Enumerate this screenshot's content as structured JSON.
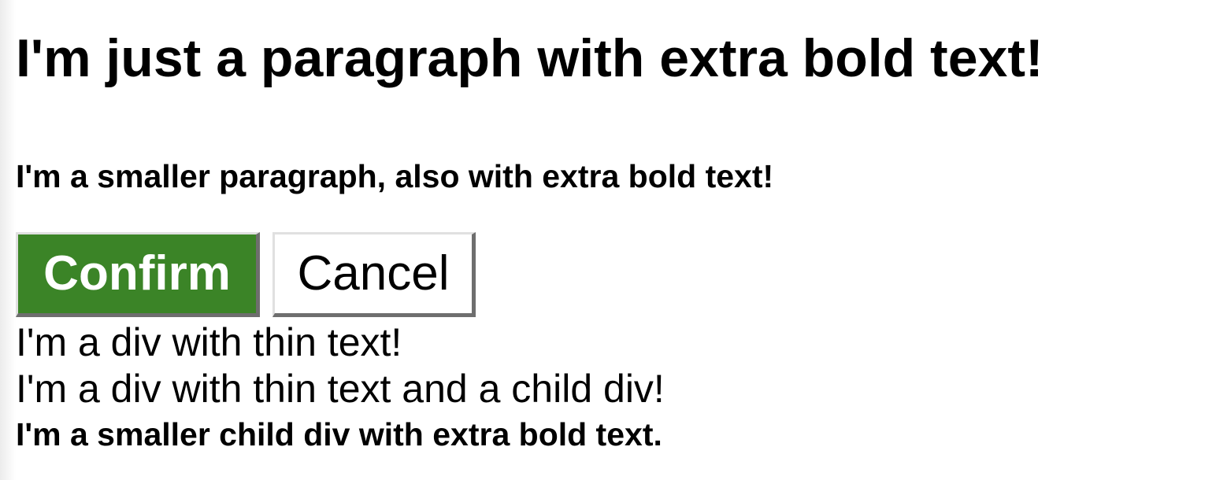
{
  "paragraphs": {
    "big": "I'm just a paragraph with extra bold text!",
    "small": "I'm a smaller paragraph, also with extra bold text!"
  },
  "buttons": {
    "confirm_label": "Confirm",
    "cancel_label": "Cancel",
    "confirm_color": "#3b8427"
  },
  "divs": {
    "thin": "I'm a div with thin text!",
    "thin_parent": "I'm a div with thin text and a child div!",
    "child": "I'm a smaller child div with extra bold text."
  }
}
